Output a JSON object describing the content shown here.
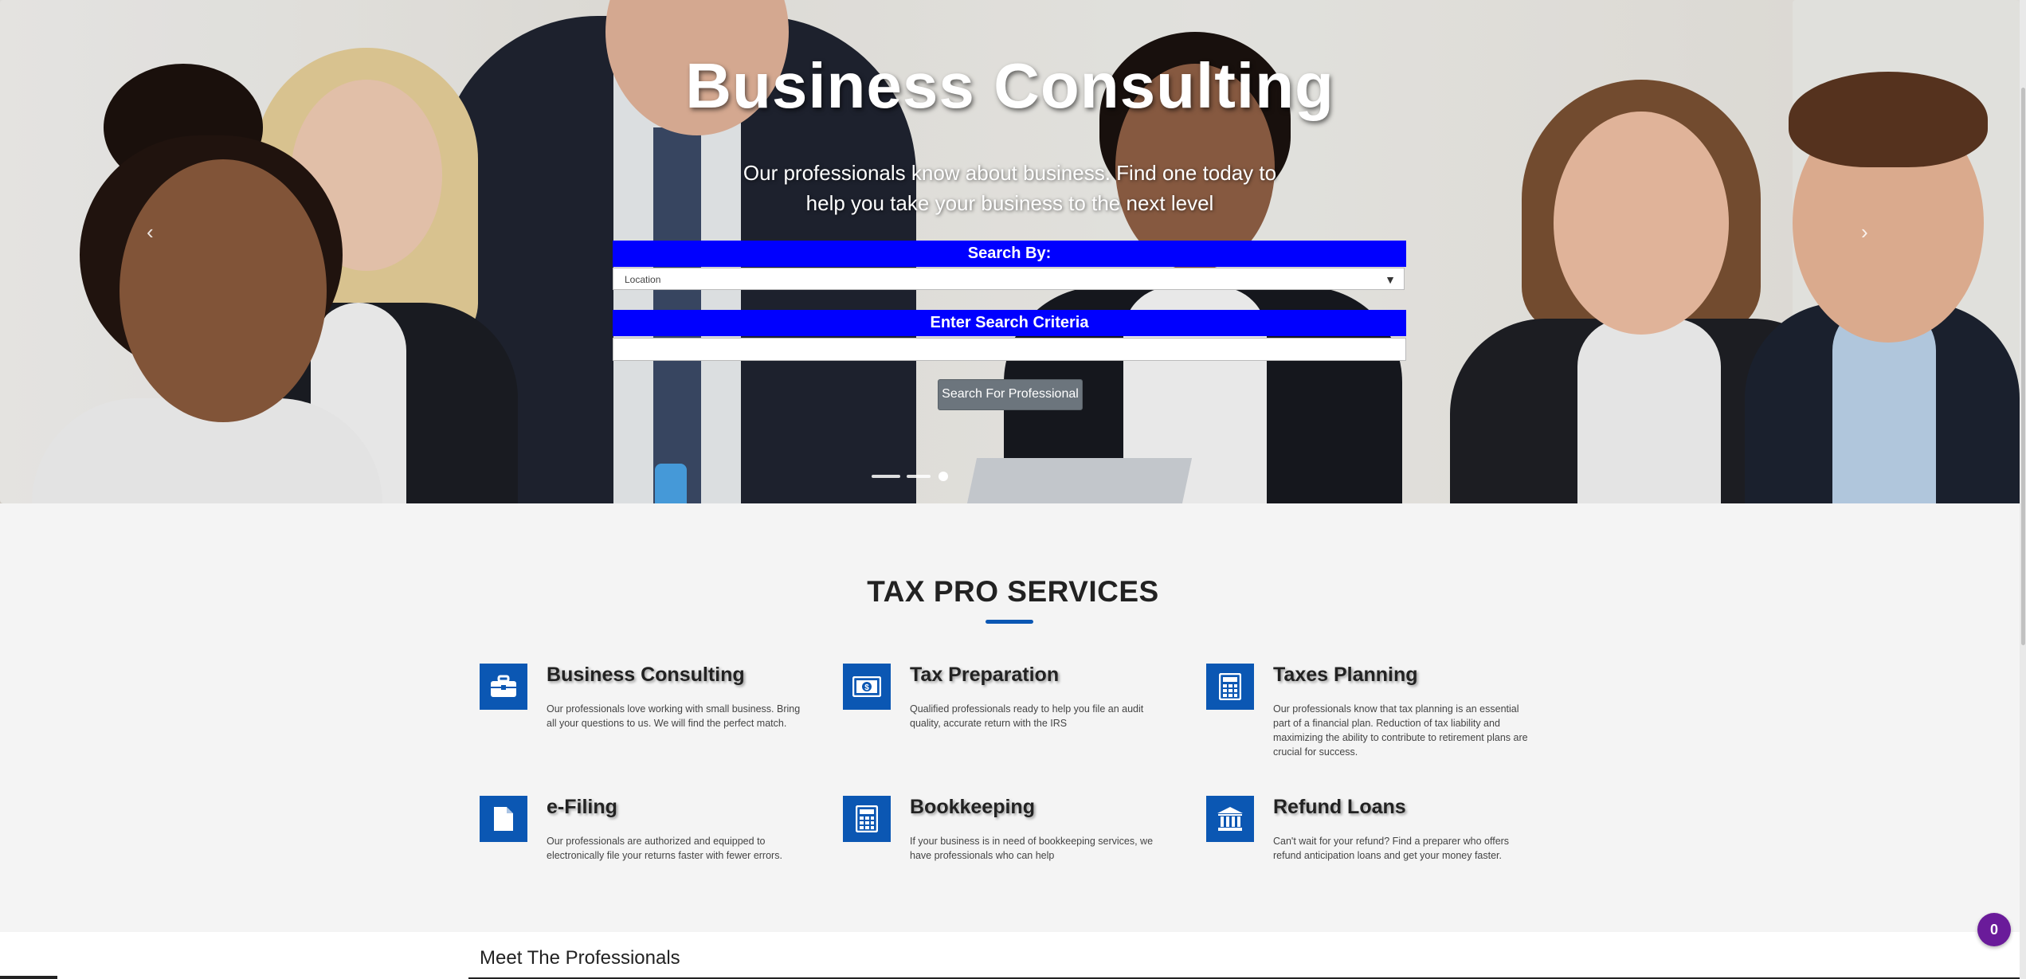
{
  "hero": {
    "title": "Business Consulting",
    "subtitle": "Our professionals know about business. Find one today to help you take your business to the next level",
    "search_by_label": "Search By:",
    "search_by_value": "Location",
    "criteria_label": "Enter Search Criteria",
    "criteria_value": "",
    "search_button": "Search For Professional",
    "prev_glyph": "‹",
    "next_glyph": "›",
    "active_slide": 3,
    "slide_count": 3
  },
  "services": {
    "title": "TAX PRO SERVICES",
    "accent_color": "#0b57b3",
    "items": [
      {
        "icon": "briefcase-icon",
        "title": "Business Consulting",
        "desc": "Our professionals love working with small business. Bring all your questions to us. We will find the perfect match."
      },
      {
        "icon": "money-icon",
        "title": "Tax Preparation",
        "desc": "Qualified professionals ready to help you file an audit quality, accurate return with the IRS"
      },
      {
        "icon": "calculator-icon",
        "title": "Taxes Planning",
        "desc": "Our professionals know that tax planning is an essential part of a financial plan. Reduction of tax liability and maximizing the ability to contribute to retirement plans are crucial for success."
      },
      {
        "icon": "file-icon",
        "title": "e-Filing",
        "desc": "Our professionals are authorized and equipped to electronically file your returns faster with fewer errors."
      },
      {
        "icon": "calculator-icon",
        "title": "Bookkeeping",
        "desc": "If your business is in need of bookkeeping services, we have professionals who can help"
      },
      {
        "icon": "bank-icon",
        "title": "Refund Loans",
        "desc": "Can't wait for your refund? Find a preparer who offers refund anticipation loans and get your money faster."
      }
    ]
  },
  "meet": {
    "title": "Meet The Professionals"
  },
  "cart": {
    "count": "0",
    "color": "#6a1b9a"
  }
}
